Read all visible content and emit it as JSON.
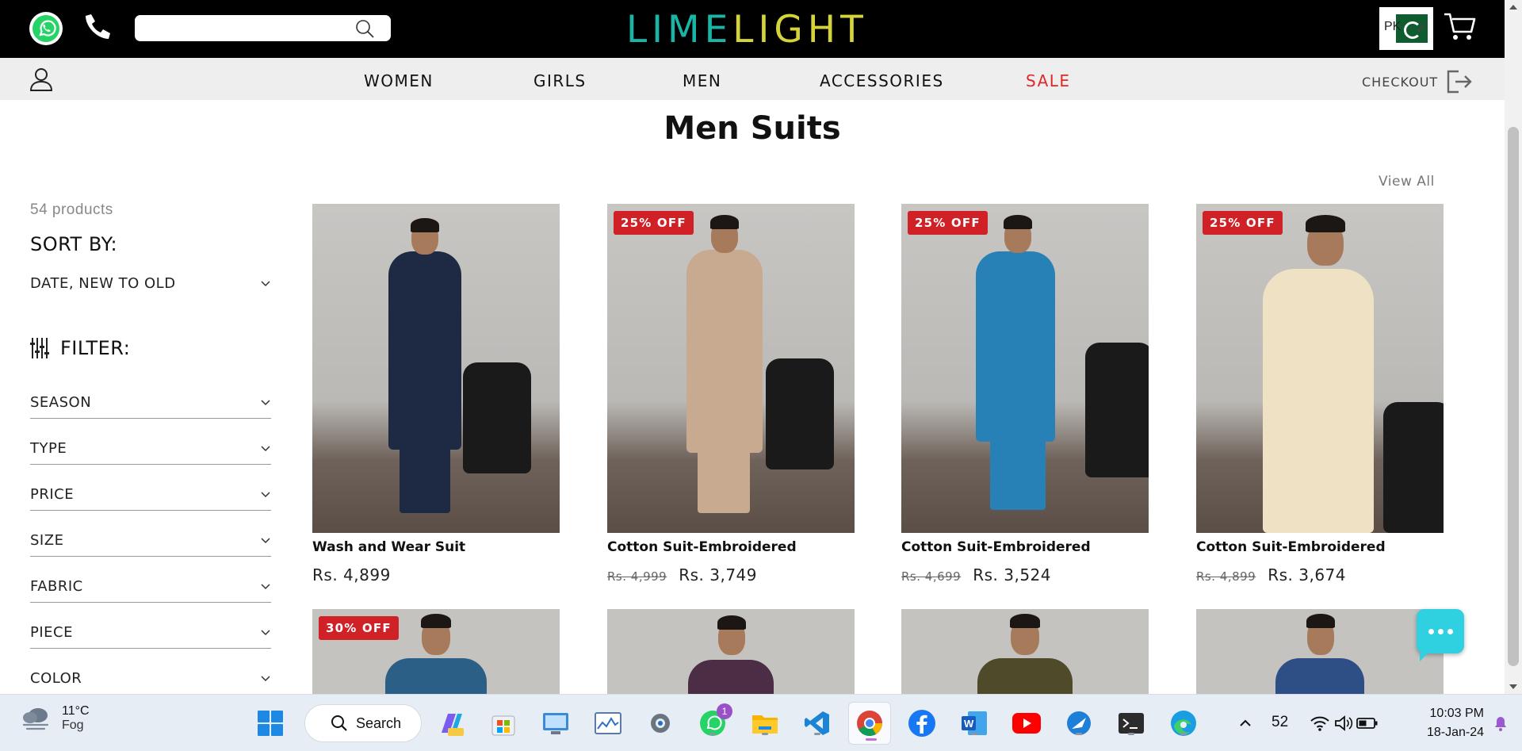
{
  "header": {
    "logo_part1": "LIME",
    "logo_part2": "LIGHT",
    "search_placeholder": "",
    "country_code": "PK",
    "icons": [
      "whatsapp-icon",
      "phone-icon",
      "search-icon",
      "cart-icon"
    ]
  },
  "nav": {
    "items": [
      "WOMEN",
      "GIRLS",
      "MEN",
      "ACCESSORIES",
      "SALE"
    ],
    "checkout": "CHECKOUT",
    "sale_color": "#e02828"
  },
  "page": {
    "title": "Men Suits",
    "view_all": "View All"
  },
  "sidebar": {
    "product_count": "54 products",
    "sort_label": "SORT BY:",
    "sort_value": "DATE, NEW TO OLD",
    "filter_label": "FILTER:",
    "filters": [
      "SEASON",
      "TYPE",
      "PRICE",
      "SIZE",
      "FABRIC",
      "PIECE",
      "COLOR"
    ]
  },
  "products": [
    {
      "name": "Wash and Wear Suit",
      "badge": "",
      "old_price": "",
      "price": "Rs. 4,899",
      "outfit_color": "#1e2a44"
    },
    {
      "name": "Cotton Suit-Embroidered",
      "badge": "25% OFF",
      "old_price": "Rs. 4,999",
      "price": "Rs. 3,749",
      "outfit_color": "#c7aa90"
    },
    {
      "name": "Cotton Suit-Embroidered",
      "badge": "25% OFF",
      "old_price": "Rs. 4,699",
      "price": "Rs. 3,524",
      "outfit_color": "#2780b6"
    },
    {
      "name": "Cotton Suit-Embroidered",
      "badge": "25% OFF",
      "old_price": "Rs. 4,899",
      "price": "Rs. 3,674",
      "outfit_color": "#efe2c4"
    }
  ],
  "products_row2": [
    {
      "badge": "30% OFF",
      "outfit_color": "#2b5f86"
    },
    {
      "badge": "",
      "outfit_color": "#4b2d45"
    },
    {
      "badge": "",
      "outfit_color": "#4e4a2a"
    },
    {
      "badge": "",
      "outfit_color": "#2e4f86"
    }
  ],
  "taskbar": {
    "temp": "11°C",
    "weather": "Fog",
    "search": "Search",
    "whatsapp_badge": "1",
    "battery": "52",
    "time": "10:03 PM",
    "date": "18-Jan-24",
    "apps": [
      "windows-start-icon",
      "copilot-icon",
      "microsoft-store-icon",
      "control-panel-icon",
      "task-manager-icon",
      "settings-icon",
      "whatsapp-icon",
      "file-explorer-icon",
      "vscode-icon",
      "chrome-icon",
      "facebook-icon",
      "word-icon",
      "youtube-icon",
      "app-icon",
      "terminal-icon",
      "edge-icon"
    ]
  }
}
